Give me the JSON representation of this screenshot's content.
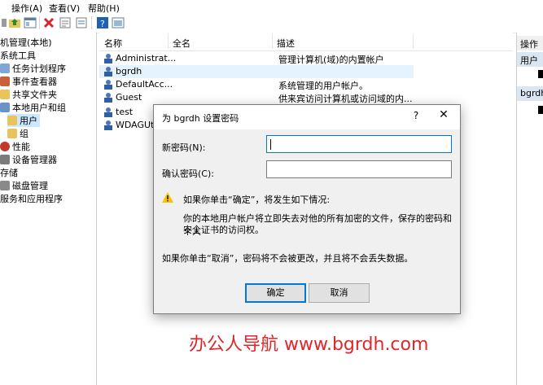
{
  "menu": {
    "action": "操作(A)",
    "view": "查看(V)",
    "help": "帮助(H)"
  },
  "tree": {
    "items": [
      {
        "label": "机管理(本地)"
      },
      {
        "label": "系统工具"
      },
      {
        "label": "任务计划程序"
      },
      {
        "label": "事件查看器"
      },
      {
        "label": "共享文件夹"
      },
      {
        "label": "本地用户和组"
      },
      {
        "label": "用户"
      },
      {
        "label": "组"
      },
      {
        "label": "性能"
      },
      {
        "label": "设备管理器"
      },
      {
        "label": "存储"
      },
      {
        "label": "磁盘管理"
      },
      {
        "label": "服务和应用程序"
      }
    ]
  },
  "list": {
    "headers": {
      "name": "名称",
      "fullname": "全名",
      "description": "描述"
    },
    "rows": [
      {
        "name": "Administrat...",
        "description": "管理计算机(域)的内置帐户"
      },
      {
        "name": "bgrdh",
        "description": ""
      },
      {
        "name": "DefaultAcc...",
        "description": "系统管理的用户帐户。"
      },
      {
        "name": "Guest",
        "description": "供来宾访问计算机或访问域的内..."
      },
      {
        "name": "test",
        "description": ""
      },
      {
        "name": "WDAGUti",
        "description": ""
      }
    ]
  },
  "actions": {
    "header": "操作",
    "group1": "用户",
    "group2": "bgrdh"
  },
  "dialog": {
    "title": "为 bgrdh 设置密码",
    "help": "?",
    "close": "✕",
    "new_password_label": "新密码(N):",
    "confirm_password_label": "确认密码(C):",
    "warning_heading": "如果你单击“确定”，将发生如下情况:",
    "warning_body_line1": "你的本地用户帐户将立即失去对他的所有加密的文件，保存的密码和个人",
    "warning_body_line2": "安全证书的访问权。",
    "cancel_note": "如果你单击“取消”，密码将不会被更改，并且将不会丢失数据。",
    "ok_label": "确定",
    "cancel_label": "取消"
  },
  "watermark": "办公人导航 www.bgrdh.com",
  "colors": {
    "selection": "#cce8ff",
    "accent": "#0078d7",
    "watermark": "#e0262a",
    "warning": "#f5c400"
  }
}
